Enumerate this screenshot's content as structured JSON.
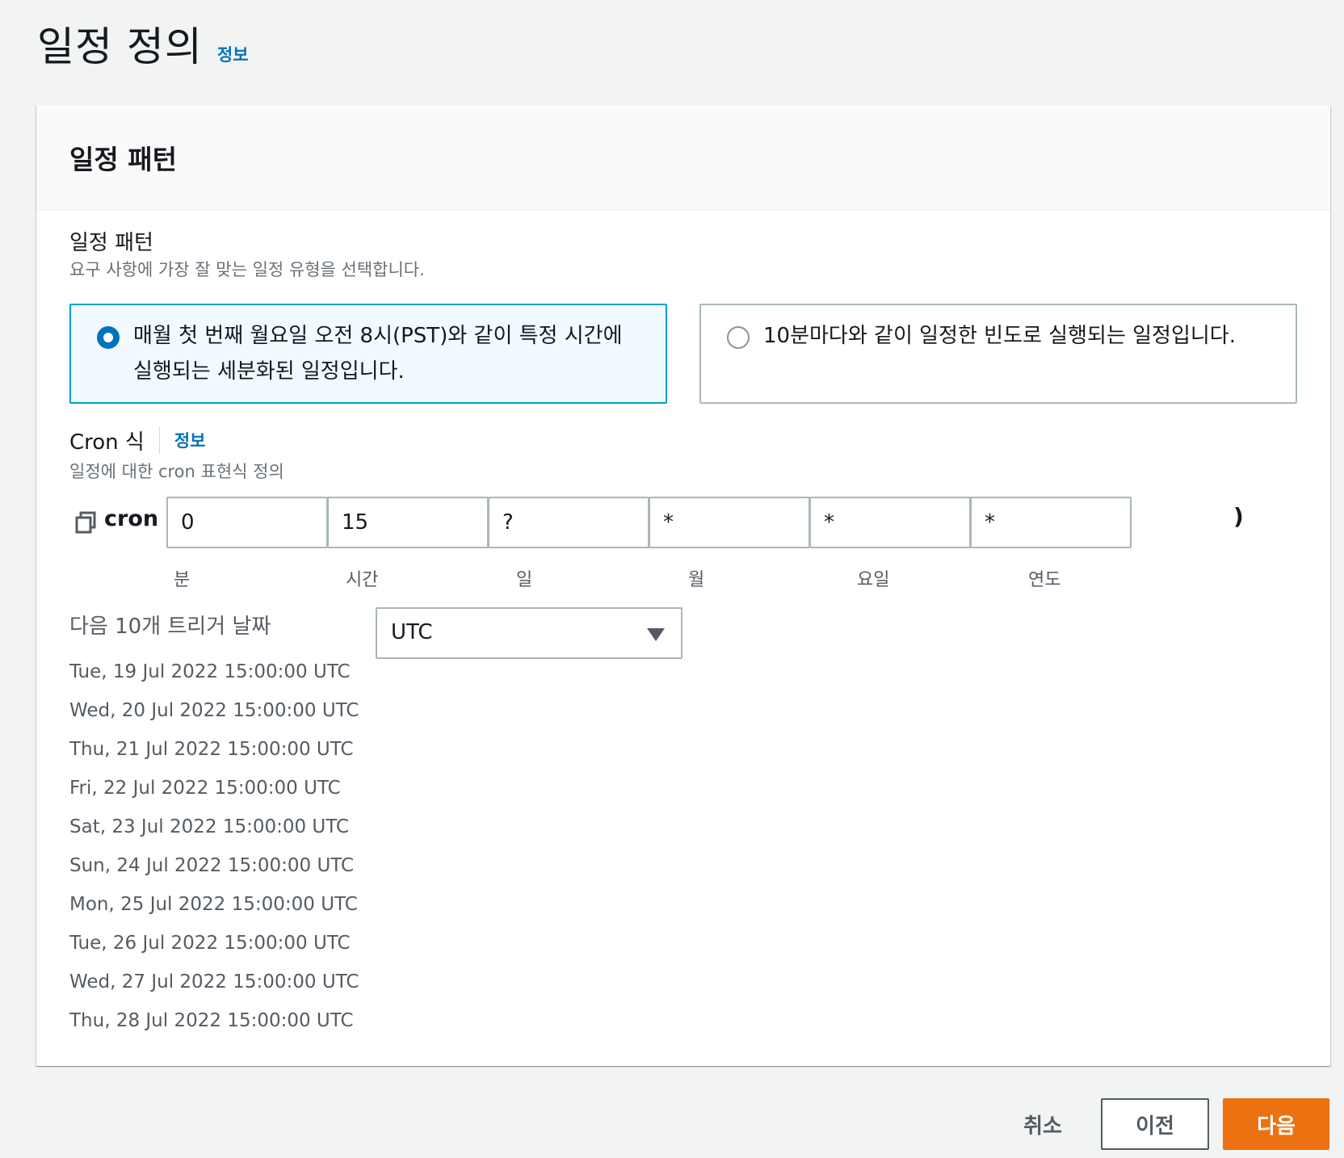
{
  "page": {
    "title": "일정 정의",
    "info": "정보"
  },
  "card": {
    "title": "일정 패턴"
  },
  "pattern": {
    "label": "일정 패턴",
    "description": "요구 사항에 가장 잘 맞는 일정 유형을 선택합니다.",
    "options": [
      {
        "text": "매월 첫 번째 월요일 오전 8시(PST)와 같이 특정 시간에 실행되는 세분화된 일정입니다.",
        "selected": true
      },
      {
        "text": "10분마다와 같이 일정한 빈도로 실행되는 일정입니다.",
        "selected": false
      }
    ]
  },
  "cron": {
    "label": "Cron 식",
    "info": "정보",
    "description": "일정에 대한 cron 표현식 정의",
    "prefix": "cron (",
    "suffix": ")",
    "fields": [
      {
        "value": "0",
        "unit": "분"
      },
      {
        "value": "15",
        "unit": "시간"
      },
      {
        "value": "?",
        "unit": "일"
      },
      {
        "value": "*",
        "unit": "월"
      },
      {
        "value": "*",
        "unit": "요일"
      },
      {
        "value": "*",
        "unit": "연도"
      }
    ]
  },
  "triggers": {
    "title": "다음 10개 트리거 날짜",
    "timezone": "UTC",
    "dates": [
      "Tue, 19 Jul 2022 15:00:00 UTC",
      "Wed, 20 Jul 2022 15:00:00 UTC",
      "Thu, 21 Jul 2022 15:00:00 UTC",
      "Fri, 22 Jul 2022 15:00:00 UTC",
      "Sat, 23 Jul 2022 15:00:00 UTC",
      "Sun, 24 Jul 2022 15:00:00 UTC",
      "Mon, 25 Jul 2022 15:00:00 UTC",
      "Tue, 26 Jul 2022 15:00:00 UTC",
      "Wed, 27 Jul 2022 15:00:00 UTC",
      "Thu, 28 Jul 2022 15:00:00 UTC"
    ]
  },
  "footer": {
    "cancel": "취소",
    "previous": "이전",
    "next": "다음"
  },
  "colors": {
    "link": "#0073bb",
    "primary": "#ec7211",
    "selected_border": "#00a1c9",
    "selected_bg": "#f1faff"
  },
  "icons": {
    "copy": "copy-icon",
    "caret": "caret-down-icon",
    "radio_checked": "radio-checked-icon",
    "radio_unchecked": "radio-unchecked-icon"
  }
}
